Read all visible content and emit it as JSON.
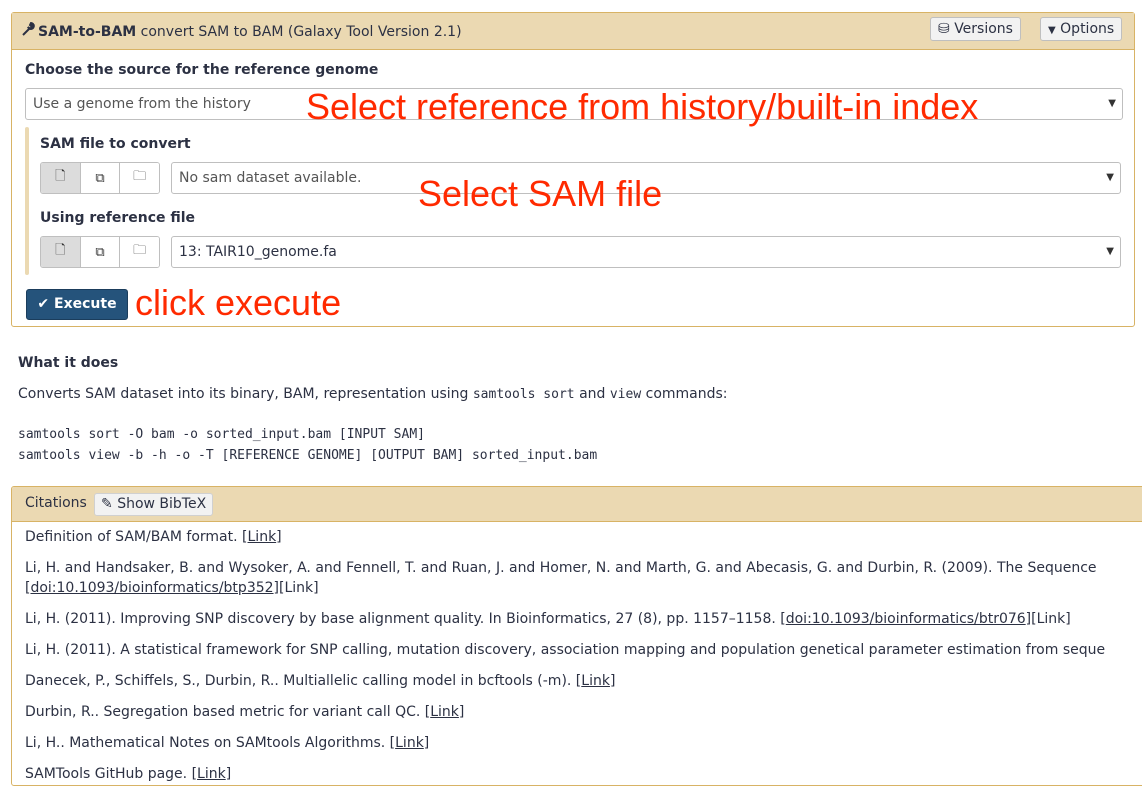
{
  "tool": {
    "name": "SAM-to-BAM",
    "description": "convert SAM to BAM (Galaxy Tool Version 2.1)",
    "versions_label": "Versions",
    "options_label": "Options"
  },
  "form": {
    "reference_source_label": "Choose the source for the reference genome",
    "reference_source_value": "Use a genome from the history",
    "sam_file_label": "SAM file to convert",
    "sam_file_value": "No sam dataset available.",
    "reference_file_label": "Using reference file",
    "reference_file_value": "13: TAIR10_genome.fa",
    "execute_label": "Execute"
  },
  "annotations": {
    "reference": "Select reference from history/built-in index",
    "sam": "Select SAM file",
    "execute": "click execute"
  },
  "help": {
    "title": "What it does",
    "intro_1": "Converts SAM dataset into its binary, BAM, representation using",
    "intro_code_1": "samtools sort",
    "intro_2": "and",
    "intro_code_2": "view",
    "intro_3": "commands:",
    "code_line_1": "samtools sort -O bam -o sorted_input.bam [INPUT SAM]",
    "code_line_2": "samtools view -b -h -o -T [REFERENCE GENOME] [OUTPUT BAM] sorted_input.bam"
  },
  "citations": {
    "title": "Citations",
    "bibtex_label": "Show BibTeX",
    "items": [
      {
        "text": "Definition of SAM/BAM format. [",
        "link": "Link",
        "tail": "]"
      },
      {
        "text": "Li, H. and Handsaker, B. and Wysoker, A. and Fennell, T. and Ruan, J. and Homer, N. and Marth, G. and Abecasis, G. and Durbin, R. (2009). The Sequence",
        "link": "",
        "tail": ""
      },
      {
        "text": "[",
        "link": "doi:10.1093/bioinformatics/btp352",
        "tail": "][Link]"
      },
      {
        "text": "Li, H. (2011). Improving SNP discovery by base alignment quality. In Bioinformatics, 27 (8), pp. 1157–1158. [",
        "link": "doi:10.1093/bioinformatics/btr076",
        "tail": "][Link]"
      },
      {
        "text": "Li, H. (2011). A statistical framework for SNP calling, mutation discovery, association mapping and population genetical parameter estimation from seque",
        "link": "",
        "tail": ""
      },
      {
        "text": "Danecek, P., Schiffels, S., Durbin, R.. Multiallelic calling model in bcftools (-m). [",
        "link": "Link",
        "tail": "]"
      },
      {
        "text": "Durbin, R.. Segregation based metric for variant call QC. [",
        "link": "Link",
        "tail": "]"
      },
      {
        "text": "Li, H.. Mathematical Notes on SAMtools Algorithms. [",
        "link": "Link",
        "tail": "]"
      },
      {
        "text": "SAMTools GitHub page. [",
        "link": "Link",
        "tail": "]"
      }
    ]
  }
}
